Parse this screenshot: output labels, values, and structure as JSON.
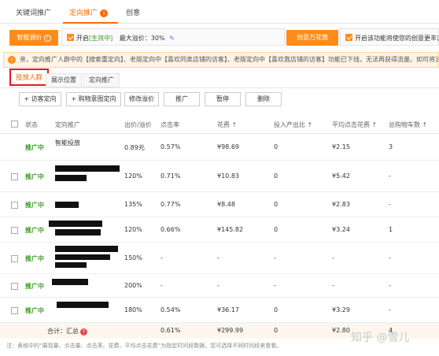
{
  "topnav": {
    "tabs": [
      {
        "label": "关键词推广"
      },
      {
        "label": "定向推广"
      },
      {
        "label": "创意"
      }
    ]
  },
  "controls": {
    "smart_price_label": "智能调价",
    "enable_label": "开启",
    "effective_label": "[生效中]",
    "max_premium_label": "最大溢价：30%",
    "creative_button_label": "创意万花筒",
    "enable_creative_label": "开启该功能将使您的创意更丰富"
  },
  "notice": {
    "text": "亲，定向推广人群中的【搜索重定向】、老版定向中【喜欢同类店铺的访客】、老版定向中【喜欢我店铺的访客】功能已下线，无法再获得流量。如可将流量"
  },
  "subtabs": [
    {
      "label": "投放人群"
    },
    {
      "label": "展示位置"
    },
    {
      "label": "定向推广"
    }
  ],
  "actions": [
    {
      "label": "+ 访客定向"
    },
    {
      "label": "+ 购物意图定向"
    },
    {
      "label": "修改溢价"
    },
    {
      "label": "推广"
    },
    {
      "label": "暂停"
    },
    {
      "label": "删除"
    }
  ],
  "table": {
    "headers": {
      "status": "状态",
      "name": "定向推广",
      "bid": "出价/溢价",
      "ctr": "点击率",
      "cost": "花费 ↑",
      "roi": "投入产出比 ↑",
      "cpc": "平均点击花费 ↑",
      "cart": "总购物车数 ↑"
    },
    "rows": [
      {
        "status": "推广中",
        "name": "智能投放",
        "bid": "0.89元",
        "ctr": "0.57%",
        "cost": "¥98.69",
        "roi": "0",
        "cpc": "¥2.15",
        "cart": "3"
      },
      {
        "status": "推广中",
        "name": "",
        "bid": "120%",
        "ctr": "0.71%",
        "cost": "¥10.83",
        "roi": "0",
        "cpc": "¥5.42",
        "cart": "-"
      },
      {
        "status": "推广中",
        "name": "",
        "bid": "135%",
        "ctr": "0.77%",
        "cost": "¥8.48",
        "roi": "0",
        "cpc": "¥2.83",
        "cart": "-"
      },
      {
        "status": "推广中",
        "name": "",
        "bid": "120%",
        "ctr": "0.66%",
        "cost": "¥145.82",
        "roi": "0",
        "cpc": "¥3.24",
        "cart": "1"
      },
      {
        "status": "推广中",
        "name": "",
        "bid": "150%",
        "ctr": "-",
        "cost": "-",
        "roi": "-",
        "cpc": "-",
        "cart": "-"
      },
      {
        "status": "推广中",
        "name": "",
        "bid": "200%",
        "ctr": "-",
        "cost": "-",
        "roi": "-",
        "cpc": "-",
        "cart": "-"
      },
      {
        "status": "推广中",
        "name": "",
        "bid": "180%",
        "ctr": "0.54%",
        "cost": "¥36.17",
        "roi": "0",
        "cpc": "¥3.29",
        "cart": "-"
      }
    ],
    "summary": {
      "label": "合计：汇总",
      "ctr": "0.61%",
      "cost": "¥299.99",
      "roi": "0",
      "cpc": "¥2.80",
      "cart": "4"
    }
  },
  "footnote": "注：表格中的“展现量、点击量、点击率、花费、平均点击花费”为指定时间段数据，您可选择不同时间段来查看。",
  "watermark": "知乎 @雪儿",
  "colors": {
    "accent": "#ff6a00",
    "status_green": "#3a9d23",
    "highlight_red": "#e31b1b"
  }
}
